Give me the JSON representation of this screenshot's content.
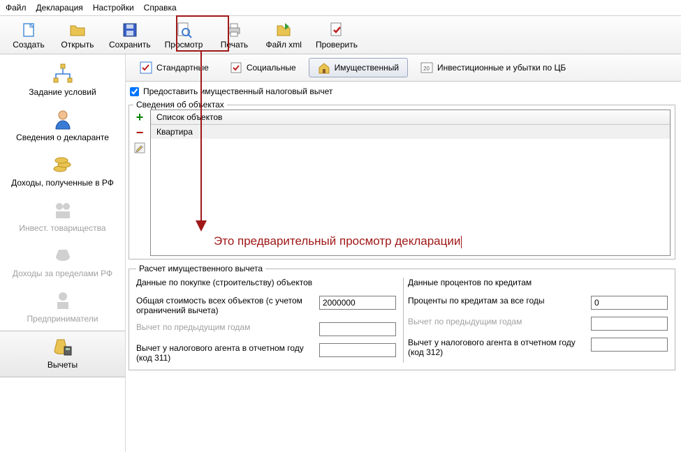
{
  "menu": [
    "Файл",
    "Декларация",
    "Настройки",
    "Справка"
  ],
  "toolbar": {
    "create": "Создать",
    "open": "Открыть",
    "save": "Сохранить",
    "preview": "Просмотр",
    "print": "Печать",
    "filexml": "Файл xml",
    "check": "Проверить"
  },
  "sidebar": {
    "conditions": "Задание условий",
    "declarant": "Сведения о декларанте",
    "income_rf": "Доходы, полученные в РФ",
    "invest": "Инвест. товарищества",
    "income_abroad": "Доходы за пределами РФ",
    "entrepreneurs": "Предприниматели",
    "deductions": "Вычеты"
  },
  "tabs": {
    "standard": "Стандартные",
    "social": "Социальные",
    "property": "Имущественный",
    "invest_cb": "Инвестиционные и убытки по ЦБ"
  },
  "checkbox_label": "Предоставить имущественный налоговый вычет",
  "objects": {
    "legend": "Сведения об объектах",
    "header": "Список объектов",
    "rows": [
      "Квартира"
    ]
  },
  "annotation": "Это предварительный просмотр декларации",
  "calc": {
    "legend": "Расчет имущественного вычета",
    "left": {
      "title": "Данные по покупке (строительству) объектов",
      "total_label": "Общая стоимость всех объектов (с учетом ограничений вычета)",
      "total_value": "2000000",
      "prev_label": "Вычет по предыдущим годам",
      "prev_value": "",
      "agent_label": "Вычет у налогового агента в отчетном году (код 311)",
      "agent_value": ""
    },
    "right": {
      "title": "Данные процентов по кредитам",
      "interest_label": "Проценты по кредитам за все годы",
      "interest_value": "0",
      "prev_label": "Вычет по предыдущим годам",
      "prev_value": "",
      "agent_label": "Вычет у налогового агента в отчетном году (код 312)",
      "agent_value": ""
    }
  }
}
